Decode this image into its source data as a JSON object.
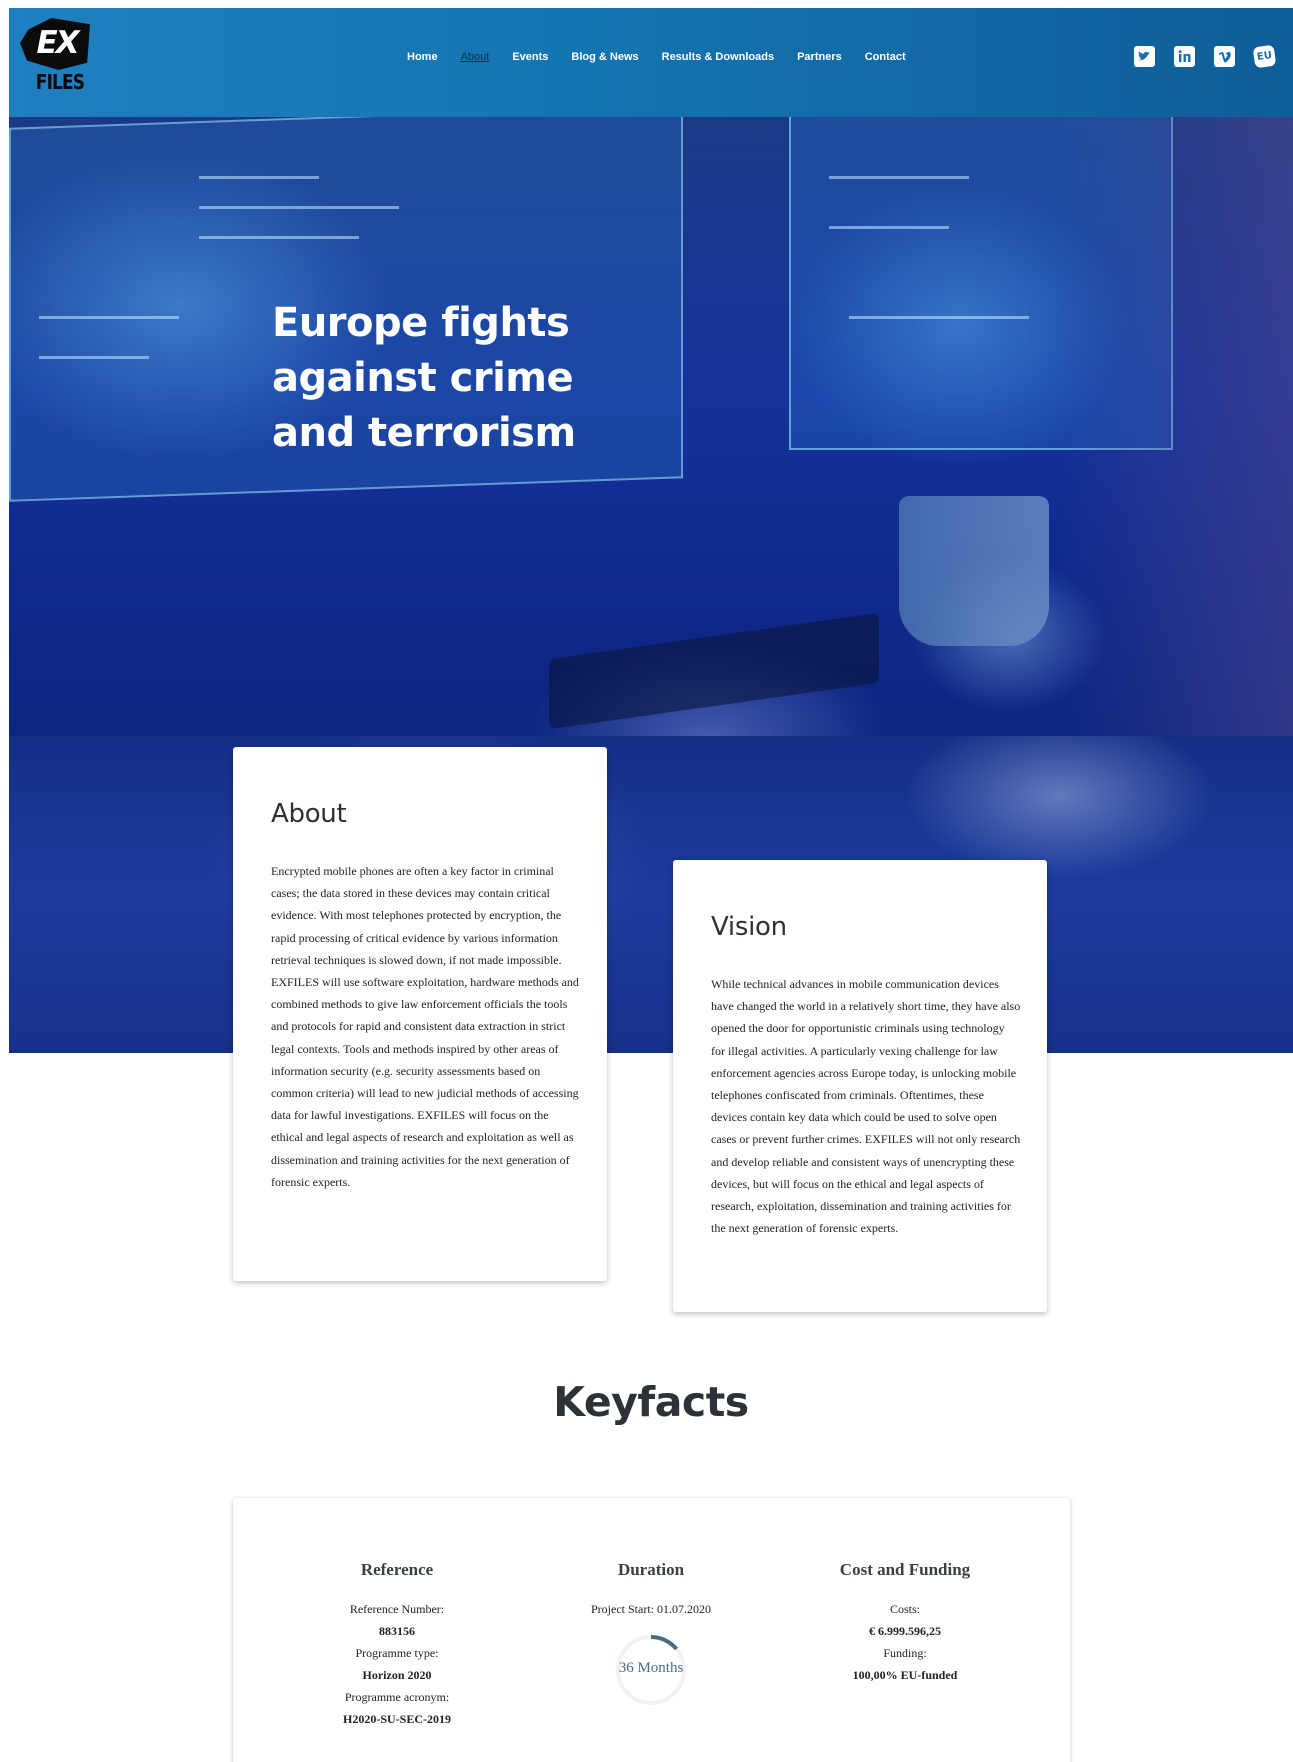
{
  "logo": {
    "ex": "EX",
    "files": "FILES"
  },
  "nav": [
    "Home",
    "About",
    "Events",
    "Blog & News",
    "Results & Downloads",
    "Partners",
    "Contact"
  ],
  "social": {
    "twitter": "twitter-icon",
    "linkedin": "linkedin-icon",
    "vimeo": "vimeo-icon",
    "eu": "EU"
  },
  "hero": {
    "line1": "Europe fights",
    "line2": "against crime",
    "line3": "and terrorism"
  },
  "about": {
    "title": "About",
    "text": "Encrypted mobile phones are often a key factor in criminal cases; the data stored in these devices may contain critical evidence. With most telephones protected by encryption, the rapid processing of critical evidence by various information retrieval techniques is slowed down, if not made impossible. EXFILES will use software exploitation, hardware methods and combined methods to give law enforcement officials the tools and protocols for rapid and consistent data extraction in strict legal contexts. Tools and methods inspired by other areas of information security (e.g. security assessments based on common criteria) will lead to new judicial methods of accessing data for lawful investigations. EXFILES will focus on the ethical and legal aspects of research and exploitation as well as dissemination and training activities for the next generation of forensic experts."
  },
  "vision": {
    "title": "Vision",
    "text": "While technical advances in mobile communication devices have changed the world in a relatively short time, they have also opened the door for opportunistic criminals using technology for illegal activities. A particularly vexing challenge for law enforcement agencies across Europe today, is unlocking mobile telephones confiscated from criminals. Oftentimes, these devices contain key data which could be used to solve open cases or prevent further crimes. EXFILES will not only research and develop reliable and consistent ways of unencrypting these devices, but will focus on the ethical and legal aspects of research, exploitation, dissemination and training activities for the next generation of forensic experts."
  },
  "keyfacts": {
    "title": "Keyfacts",
    "reference": {
      "title": "Reference",
      "ref_label": "Reference Number:",
      "ref_value": "883156",
      "prog_label": "Programme type:",
      "prog_value": "Horizon 2020",
      "acr_label": "Programme acronym:",
      "acr_value": "H2020-SU-SEC-2019"
    },
    "duration": {
      "title": "Duration",
      "start": "Project Start: 01.07.2020",
      "months": "36 Months",
      "elapsed_fraction": 0.14
    },
    "funding": {
      "title": "Cost and Funding",
      "costs_label": "Costs:",
      "costs_value": "€ 6.999.596,25",
      "funding_label": "Funding:",
      "funding_value": "100,00% EU-funded"
    }
  },
  "colors": {
    "header": "#1576b3",
    "hero": "#15329b",
    "text": "#2d3138",
    "dial": "#4b6b80"
  }
}
